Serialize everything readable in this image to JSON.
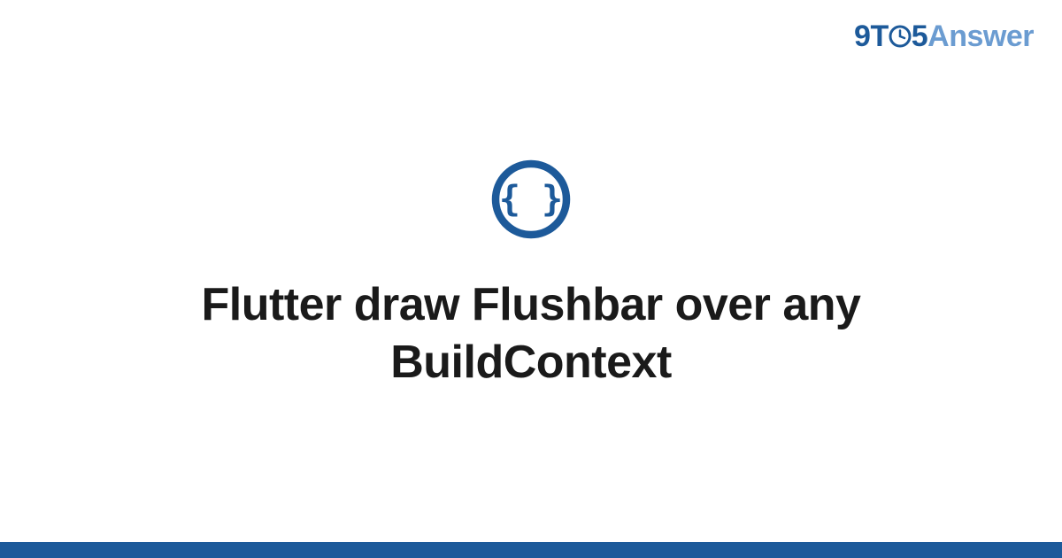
{
  "brand": {
    "part1": "9",
    "part2": "T",
    "part3": "5",
    "part4": "Answer"
  },
  "icon": {
    "name": "code-braces-icon",
    "glyph": "{ }"
  },
  "title": "Flutter draw Flushbar over any BuildContext",
  "colors": {
    "brand_primary": "#1d5a9a",
    "brand_secondary": "#6b9cd1",
    "text": "#1a1a1a",
    "bar": "#1d5a9a"
  }
}
